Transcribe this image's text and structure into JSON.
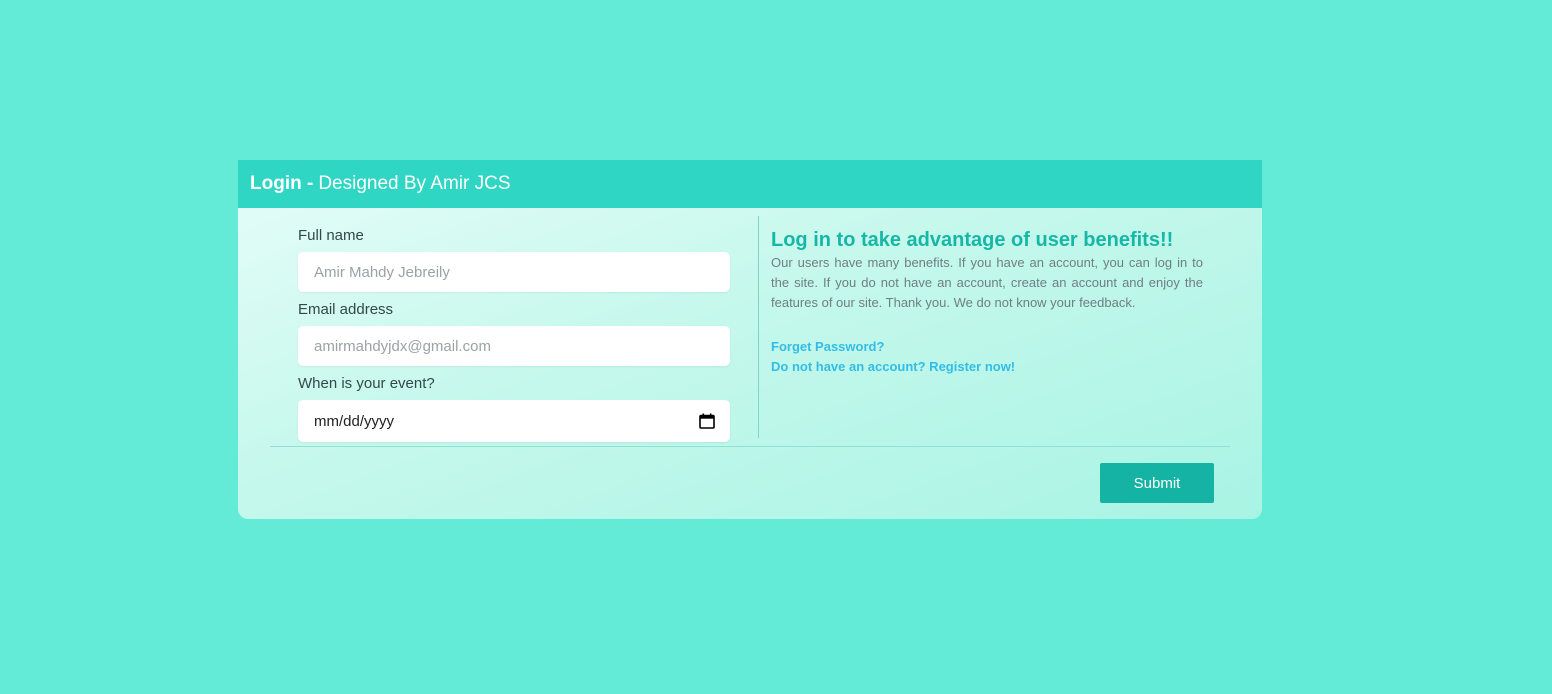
{
  "header": {
    "title_strong": "Login -",
    "title_rest": "Designed By Amir JCS"
  },
  "form": {
    "full_name": {
      "label": "Full name",
      "placeholder": "Amir Mahdy Jebreily"
    },
    "email": {
      "label": "Email address",
      "placeholder": "amirmahdyjdx@gmail.com"
    },
    "event": {
      "label": "When is your event?",
      "placeholder": "mm/dd/yyyy",
      "icon": "calendar-icon"
    }
  },
  "info": {
    "heading": "Log in to take advantage of user benefits!!",
    "body": "Our users have many benefits. If you have an account, you can log in to the site. If you do not have an account, create an account and enjoy the features of our site. Thank you. We do not know your feedback.",
    "forget_link": "Forget Password?",
    "register_link": "Do not have an account? Register now!"
  },
  "footer": {
    "submit_label": "Submit"
  },
  "colors": {
    "background": "#63ebd8",
    "header": "#2fd6c3",
    "accent": "#17b7a6",
    "link": "#33bde6",
    "button": "#14b3a3"
  }
}
